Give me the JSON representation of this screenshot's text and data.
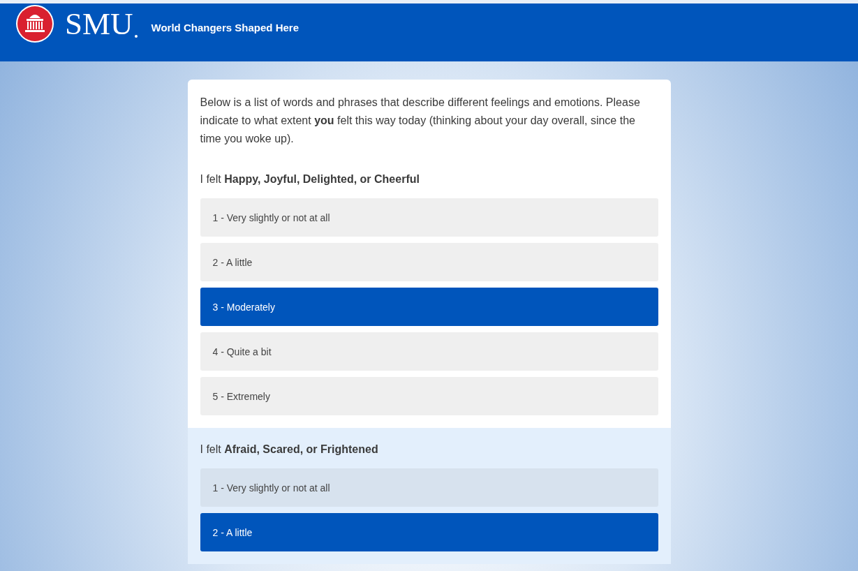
{
  "header": {
    "logo_text": "SMU",
    "tagline": "World Changers Shaped Here"
  },
  "intro": "Below is a list of words and phrases that describe different feelings and emotions. Please indicate to what extent **you** felt this way today (thinking about your day overall, since the time you woke up).",
  "questions": [
    {
      "prompt": "I felt **Happy, Joyful, Delighted, or Cheerful**",
      "highlighted": false,
      "options": [
        {
          "label": "1 - Very slightly or not at all",
          "selected": false
        },
        {
          "label": "2 - A little",
          "selected": false
        },
        {
          "label": "3 - Moderately",
          "selected": true
        },
        {
          "label": "4 - Quite a bit",
          "selected": false
        },
        {
          "label": "5 - Extremely",
          "selected": false
        }
      ]
    },
    {
      "prompt": "I felt **Afraid, Scared, or Frightened**",
      "highlighted": true,
      "options": [
        {
          "label": "1 - Very slightly or not at all",
          "selected": false
        },
        {
          "label": "2 - A little",
          "selected": true
        }
      ]
    }
  ]
}
